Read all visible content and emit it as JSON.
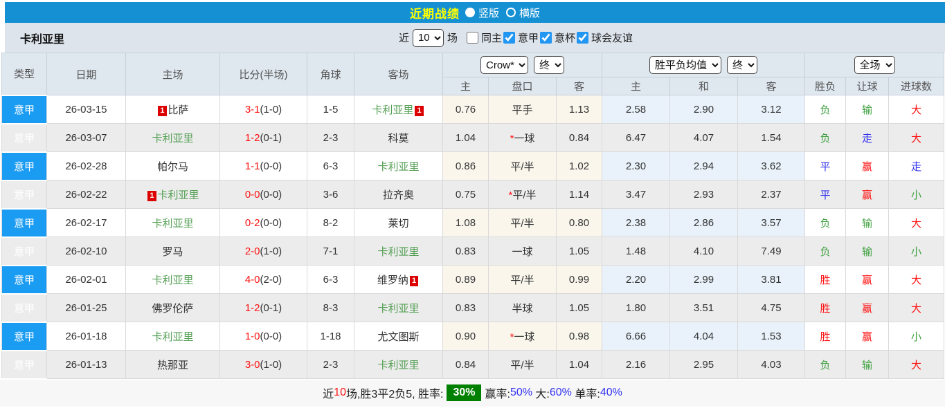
{
  "colors": {
    "top_bar_blue": "#1591d3",
    "type_cell_blue": "#1b9cf3",
    "title_yellow": "#ffff00",
    "team_green": "#55a055",
    "score_red": "#ff1111",
    "result_blue": "#3333f0",
    "result_green": "#3fa03f",
    "odds_cream_bg": "#faf6ec",
    "avg_blue_bg": "#e9f2fa",
    "badge_green_bg": "#008000"
  },
  "top_bar": {
    "title": "近期战绩",
    "radios": [
      {
        "label": "竖版",
        "selected": true
      },
      {
        "label": "横版",
        "selected": false
      }
    ]
  },
  "filter": {
    "team": "卡利亚里",
    "near_label": "近",
    "count": "10",
    "games_label": "场",
    "checkboxes": [
      {
        "label": "同主",
        "checked": false
      },
      {
        "label": "意甲",
        "checked": true
      },
      {
        "label": "意杯",
        "checked": true
      },
      {
        "label": "球会友谊",
        "checked": true
      }
    ]
  },
  "table": {
    "main_headers": [
      "类型",
      "日期",
      "主场",
      "比分(半场)",
      "角球",
      "客场"
    ],
    "selects": {
      "odds_primary": "Crow*",
      "odds_stage": "终",
      "avg_primary": "胜平负均值",
      "avg_stage": "终",
      "result_scope": "全场"
    },
    "sub_headers": [
      "主",
      "盘口",
      "客",
      "主",
      "和",
      "客",
      "胜负",
      "让球",
      "进球数"
    ],
    "rows": [
      {
        "league": "意甲",
        "date": "26-03-15",
        "home": {
          "name": "比萨",
          "green": false,
          "card": "1",
          "card_pos": "before"
        },
        "score": {
          "ft": "3-1",
          "ht": "(1-0)"
        },
        "corner": "1-5",
        "away": {
          "name": "卡利亚里",
          "green": true,
          "card": "1",
          "card_pos": "after"
        },
        "odds": {
          "h": "0.76",
          "star": false,
          "line": "平手",
          "a": "1.13"
        },
        "avg": {
          "h": "2.58",
          "d": "2.90",
          "a": "3.12"
        },
        "result": [
          {
            "t": "负",
            "c": "green"
          },
          {
            "t": "输",
            "c": "green"
          },
          {
            "t": "大",
            "c": "red"
          }
        ]
      },
      {
        "league": "意甲",
        "date": "26-03-07",
        "home": {
          "name": "卡利亚里",
          "green": true,
          "card": null,
          "card_pos": null
        },
        "score": {
          "ft": "1-2",
          "ht": "(0-1)"
        },
        "corner": "2-3",
        "away": {
          "name": "科莫",
          "green": false,
          "card": null,
          "card_pos": null
        },
        "odds": {
          "h": "1.04",
          "star": true,
          "line": "一球",
          "a": "0.84"
        },
        "avg": {
          "h": "6.47",
          "d": "4.07",
          "a": "1.54"
        },
        "result": [
          {
            "t": "负",
            "c": "green"
          },
          {
            "t": "走",
            "c": "blue"
          },
          {
            "t": "大",
            "c": "red"
          }
        ]
      },
      {
        "league": "意甲",
        "date": "26-02-28",
        "home": {
          "name": "帕尔马",
          "green": false,
          "card": null,
          "card_pos": null
        },
        "score": {
          "ft": "1-1",
          "ht": "(0-0)"
        },
        "corner": "6-3",
        "away": {
          "name": "卡利亚里",
          "green": true,
          "card": null,
          "card_pos": null
        },
        "odds": {
          "h": "0.86",
          "star": false,
          "line": "平/半",
          "a": "1.02"
        },
        "avg": {
          "h": "2.30",
          "d": "2.94",
          "a": "3.62"
        },
        "result": [
          {
            "t": "平",
            "c": "blue"
          },
          {
            "t": "赢",
            "c": "red"
          },
          {
            "t": "走",
            "c": "blue"
          }
        ]
      },
      {
        "league": "意甲",
        "date": "26-02-22",
        "home": {
          "name": "卡利亚里",
          "green": true,
          "card": "1",
          "card_pos": "before"
        },
        "score": {
          "ft": "0-0",
          "ht": "(0-0)"
        },
        "corner": "3-6",
        "away": {
          "name": "拉齐奥",
          "green": false,
          "card": null,
          "card_pos": null
        },
        "odds": {
          "h": "0.75",
          "star": true,
          "line": "平/半",
          "a": "1.14"
        },
        "avg": {
          "h": "3.47",
          "d": "2.93",
          "a": "2.37"
        },
        "result": [
          {
            "t": "平",
            "c": "blue"
          },
          {
            "t": "赢",
            "c": "red"
          },
          {
            "t": "小",
            "c": "green"
          }
        ]
      },
      {
        "league": "意甲",
        "date": "26-02-17",
        "home": {
          "name": "卡利亚里",
          "green": true,
          "card": null,
          "card_pos": null
        },
        "score": {
          "ft": "0-2",
          "ht": "(0-0)"
        },
        "corner": "8-2",
        "away": {
          "name": "莱切",
          "green": false,
          "card": null,
          "card_pos": null
        },
        "odds": {
          "h": "1.08",
          "star": false,
          "line": "平/半",
          "a": "0.80"
        },
        "avg": {
          "h": "2.38",
          "d": "2.86",
          "a": "3.57"
        },
        "result": [
          {
            "t": "负",
            "c": "green"
          },
          {
            "t": "输",
            "c": "green"
          },
          {
            "t": "大",
            "c": "red"
          }
        ]
      },
      {
        "league": "意甲",
        "date": "26-02-10",
        "home": {
          "name": "罗马",
          "green": false,
          "card": null,
          "card_pos": null
        },
        "score": {
          "ft": "2-0",
          "ht": "(1-0)"
        },
        "corner": "7-1",
        "away": {
          "name": "卡利亚里",
          "green": true,
          "card": null,
          "card_pos": null
        },
        "odds": {
          "h": "0.83",
          "star": false,
          "line": "一球",
          "a": "1.05"
        },
        "avg": {
          "h": "1.48",
          "d": "4.10",
          "a": "7.49"
        },
        "result": [
          {
            "t": "负",
            "c": "green"
          },
          {
            "t": "输",
            "c": "green"
          },
          {
            "t": "小",
            "c": "green"
          }
        ]
      },
      {
        "league": "意甲",
        "date": "26-02-01",
        "home": {
          "name": "卡利亚里",
          "green": true,
          "card": null,
          "card_pos": null
        },
        "score": {
          "ft": "4-0",
          "ht": "(2-0)"
        },
        "corner": "6-3",
        "away": {
          "name": "维罗纳",
          "green": false,
          "card": "1",
          "card_pos": "after"
        },
        "odds": {
          "h": "0.89",
          "star": false,
          "line": "平/半",
          "a": "0.99"
        },
        "avg": {
          "h": "2.20",
          "d": "2.99",
          "a": "3.81"
        },
        "result": [
          {
            "t": "胜",
            "c": "red"
          },
          {
            "t": "赢",
            "c": "red"
          },
          {
            "t": "大",
            "c": "red"
          }
        ]
      },
      {
        "league": "意甲",
        "date": "26-01-25",
        "home": {
          "name": "佛罗伦萨",
          "green": false,
          "card": null,
          "card_pos": null
        },
        "score": {
          "ft": "1-2",
          "ht": "(0-1)"
        },
        "corner": "8-3",
        "away": {
          "name": "卡利亚里",
          "green": true,
          "card": null,
          "card_pos": null
        },
        "odds": {
          "h": "0.83",
          "star": false,
          "line": "半球",
          "a": "1.05"
        },
        "avg": {
          "h": "1.80",
          "d": "3.51",
          "a": "4.75"
        },
        "result": [
          {
            "t": "胜",
            "c": "red"
          },
          {
            "t": "赢",
            "c": "red"
          },
          {
            "t": "大",
            "c": "red"
          }
        ]
      },
      {
        "league": "意甲",
        "date": "26-01-18",
        "home": {
          "name": "卡利亚里",
          "green": true,
          "card": null,
          "card_pos": null
        },
        "score": {
          "ft": "1-0",
          "ht": "(0-0)"
        },
        "corner": "1-18",
        "away": {
          "name": "尤文图斯",
          "green": false,
          "card": null,
          "card_pos": null
        },
        "odds": {
          "h": "0.90",
          "star": true,
          "line": "一球",
          "a": "0.98"
        },
        "avg": {
          "h": "6.66",
          "d": "4.04",
          "a": "1.53"
        },
        "result": [
          {
            "t": "胜",
            "c": "red"
          },
          {
            "t": "赢",
            "c": "red"
          },
          {
            "t": "小",
            "c": "green"
          }
        ]
      },
      {
        "league": "意甲",
        "date": "26-01-13",
        "home": {
          "name": "热那亚",
          "green": false,
          "card": null,
          "card_pos": null
        },
        "score": {
          "ft": "3-0",
          "ht": "(1-0)"
        },
        "corner": "2-3",
        "away": {
          "name": "卡利亚里",
          "green": true,
          "card": null,
          "card_pos": null
        },
        "odds": {
          "h": "0.84",
          "star": false,
          "line": "平/半",
          "a": "1.04"
        },
        "avg": {
          "h": "2.16",
          "d": "2.95",
          "a": "4.03"
        },
        "result": [
          {
            "t": "负",
            "c": "green"
          },
          {
            "t": "输",
            "c": "green"
          },
          {
            "t": "大",
            "c": "red"
          }
        ]
      }
    ]
  },
  "summary": {
    "segments": [
      {
        "t": "近",
        "c": "k"
      },
      {
        "t": "10",
        "c": "red"
      },
      {
        "t": "场,胜3平2负5, 胜率:",
        "c": "k"
      },
      {
        "t": "30%",
        "c": "badge"
      },
      {
        "t": "赢率:",
        "c": "k"
      },
      {
        "t": "50%",
        "c": "blue"
      },
      {
        "t": " 大:",
        "c": "k"
      },
      {
        "t": "60%",
        "c": "blue"
      },
      {
        "t": " 单率:",
        "c": "k"
      },
      {
        "t": "40%",
        "c": "blue"
      }
    ]
  }
}
